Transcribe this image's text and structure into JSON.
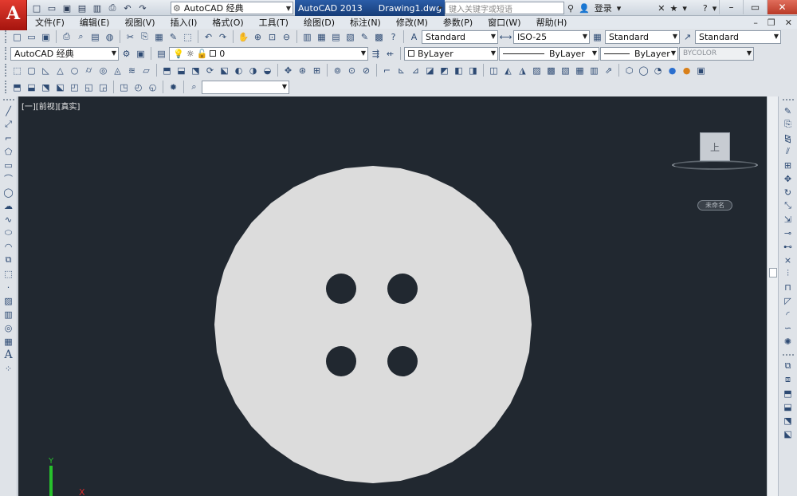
{
  "app_title": "AutoCAD 2013",
  "document_title": "Drawing1.dwg",
  "workspace": "AutoCAD 经典",
  "search_placeholder": "键入关键字或短语",
  "login_label": "登录",
  "menu": [
    "文件(F)",
    "编辑(E)",
    "视图(V)",
    "插入(I)",
    "格式(O)",
    "工具(T)",
    "绘图(D)",
    "标注(N)",
    "修改(M)",
    "参数(P)",
    "窗口(W)",
    "帮助(H)"
  ],
  "styles": {
    "text_style": "Standard",
    "dim_style": "ISO-25",
    "table_style": "Standard",
    "multileader_style": "Standard"
  },
  "workspace_combo": "AutoCAD 经典",
  "layer": "0",
  "properties": {
    "color": "ByLayer",
    "linetype": "ByLayer",
    "lineweight": "ByLayer",
    "plot_style": "BYCOLOR"
  },
  "viewport_label": "[一][前视][真实]",
  "viewcube_face": "上",
  "wcs_label": "未命名",
  "ucs": {
    "y": "Y",
    "x": "X"
  },
  "colors": {
    "canvas": "#212830",
    "button_fill": "#dcdcdc",
    "hole_fill": "#212830",
    "ucs_y": "#27c12c",
    "ucs_x": "#d82a2a",
    "title_accent": "#173d78"
  }
}
